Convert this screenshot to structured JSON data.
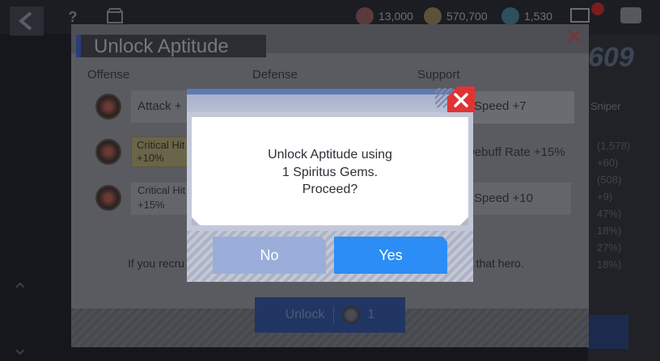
{
  "hud": {
    "resources": [
      {
        "icon": "stamina-icon",
        "value": "13,000",
        "color": "#5a3a3d"
      },
      {
        "icon": "gold-icon",
        "value": "570,700",
        "color": "#5d5238"
      },
      {
        "icon": "crystal-icon",
        "value": "1,530",
        "color": "#2e4f5e"
      }
    ],
    "menu_icons": [
      "help-icon",
      "shop-icon"
    ]
  },
  "right_panel": {
    "big_number": "609",
    "sub_label": "Sniper",
    "rows": [
      "(1,578)",
      "+60)",
      "(508)",
      "+9)",
      "47%)",
      "18%)",
      "27%)",
      "18%)"
    ]
  },
  "background_dialog": {
    "title": "Unlock Aptitude",
    "columns": [
      "Offense",
      "Defense",
      "Support"
    ],
    "offense_options": [
      "Attack +",
      "Critical Hit\n+10%",
      "Critical Hit\n+15%"
    ],
    "support_options": [
      "Speed +7",
      "Debuff Rate +15%",
      "Speed +10"
    ],
    "note_left": "If you recru",
    "note_right": "r that hero.",
    "unlock_button": {
      "label": "Unlock",
      "count": "1"
    }
  },
  "modal": {
    "message": [
      "Unlock Aptitude using",
      "1 Spiritus Gems.",
      "Proceed?"
    ],
    "no_label": "No",
    "yes_label": "Yes"
  },
  "colors": {
    "yes_button": "#2b8df5",
    "no_button": "#9aaed9",
    "close_button": "#e03434",
    "modal_frame": "#c3c8d9"
  }
}
